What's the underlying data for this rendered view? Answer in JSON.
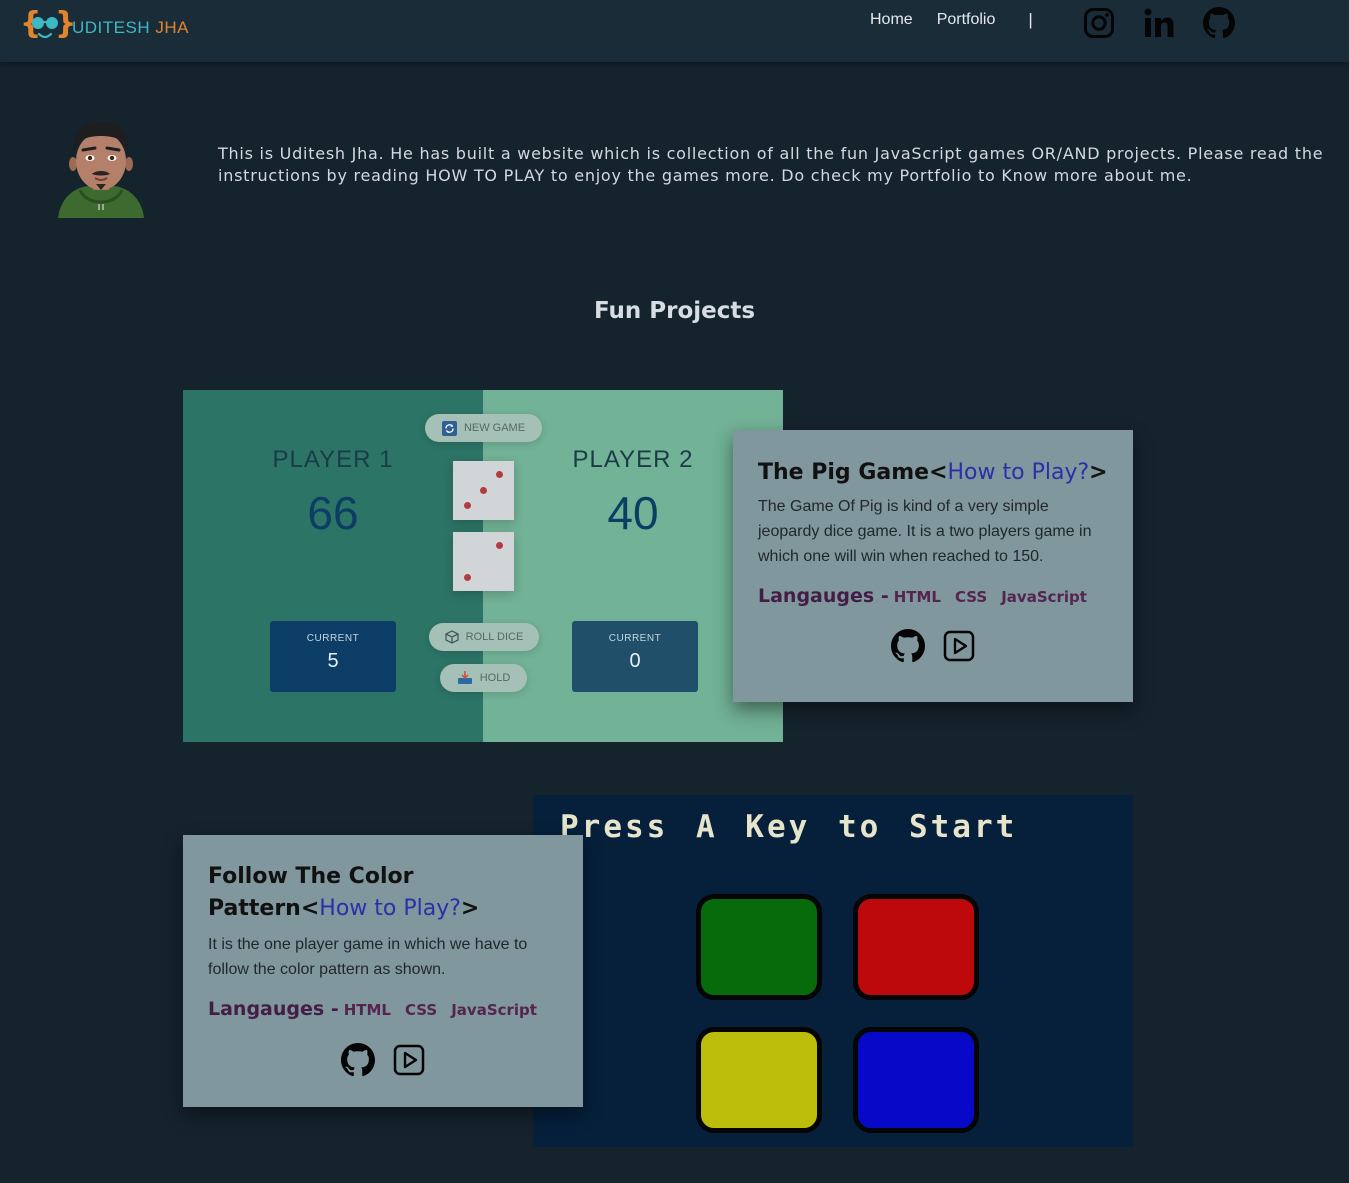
{
  "navbar": {
    "logo": {
      "brace_open": "{",
      "brace_close": "}",
      "first_name": "UDITESH",
      "last_name": "JHA"
    },
    "links": {
      "home": "Home",
      "portfolio": "Portfolio",
      "separator": "|"
    },
    "social_icons": [
      "instagram-icon",
      "linkedin-icon",
      "github-icon"
    ]
  },
  "intro": {
    "text": "This is Uditesh Jha. He has built a website which is collection of all the fun JavaScript games OR/AND projects. Please read the instructions by reading HOW TO PLAY to enjoy the games more. Do check my Portfolio to Know more about me."
  },
  "section_title": "Fun Projects",
  "projects": [
    {
      "title": "The Pig Game",
      "title_open": "<",
      "how_to": "How to Play?",
      "title_close": ">",
      "description": "The Game Of Pig is kind of a very simple jeopardy dice game. It is a two players game in which one will win when reached to 150.",
      "languages_label": "Langauges -",
      "languages": [
        "HTML",
        "CSS",
        "JavaScript"
      ],
      "preview": {
        "new_game": "NEW GAME",
        "roll_dice": "ROLL DICE",
        "hold": "HOLD",
        "player1": {
          "name": "PLAYER 1",
          "score": "66",
          "current_label": "CURRENT",
          "current": "5"
        },
        "player2": {
          "name": "PLAYER 2",
          "score": "40",
          "current_label": "CURRENT",
          "current": "0"
        },
        "dice": [
          3,
          2
        ]
      }
    },
    {
      "title": "Follow The Color Pattern",
      "title_open": "<",
      "how_to": "How to Play?",
      "title_close": ">",
      "description": "It is the one player game in which we have to follow the color pattern as shown.",
      "languages_label": "Langauges -",
      "languages": [
        "HTML",
        "CSS",
        "JavaScript"
      ],
      "preview": {
        "title": "Press A Key to Start",
        "buttons": [
          "green",
          "red",
          "yellow",
          "blue"
        ]
      }
    }
  ],
  "colors": {
    "page_bg": "#15232d",
    "navbar_bg": "#1b2c39",
    "card_bg": "#80979d",
    "logo_cyan": "#3db9c4",
    "logo_orange": "#e2832d",
    "link_blue": "#2c2fa8",
    "simon_green": "#086b0b",
    "simon_red": "#bd090b",
    "simon_yellow": "#bcbd0b",
    "simon_blue": "#0809c8"
  }
}
